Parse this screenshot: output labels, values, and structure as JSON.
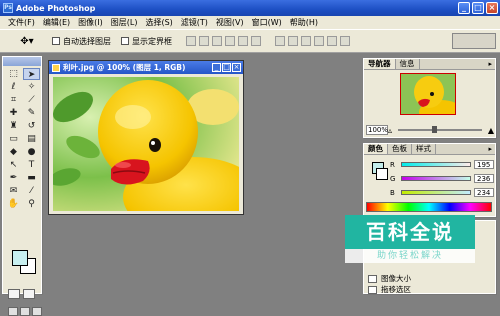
{
  "window": {
    "title": "Adobe Photoshop"
  },
  "menu": [
    "文件(F)",
    "编辑(E)",
    "图像(I)",
    "图层(L)",
    "选择(S)",
    "滤镜(T)",
    "视图(V)",
    "窗口(W)",
    "帮助(H)"
  ],
  "options": {
    "auto_select_label": "自动选择图层",
    "show_bounds_label": "显示定界框"
  },
  "document": {
    "title": "利叶.jpg @ 100% (图层 1, RGB)"
  },
  "navigator": {
    "tabs": [
      "导航器",
      "信息"
    ],
    "zoom": "100%"
  },
  "color_panel": {
    "tabs": [
      "颜色",
      "色板",
      "样式"
    ],
    "r_label": "R",
    "g_label": "G",
    "b_label": "B",
    "r": "195",
    "g": "236",
    "b": "234"
  },
  "history": {
    "items": [
      "图像大小",
      "拖移选区"
    ]
  },
  "watermark": {
    "main": "百科全说",
    "sub": "助你轻松解决"
  },
  "colors": {
    "foreground": "#c3ecea",
    "background": "#ffffff"
  }
}
